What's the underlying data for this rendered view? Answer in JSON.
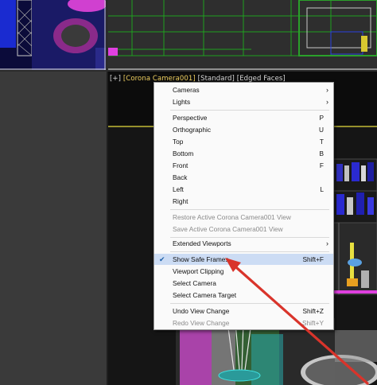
{
  "viewport": {
    "label_plus": "[+]",
    "label_camera": "[Corona Camera001]",
    "label_standard": "[Standard]",
    "label_mode": "[Edged Faces]"
  },
  "menu": {
    "items": [
      {
        "label": "Cameras",
        "shortcut": "",
        "submenu": true,
        "disabled": false
      },
      {
        "label": "Lights",
        "shortcut": "",
        "submenu": true,
        "disabled": false
      },
      {
        "label": "Perspective",
        "shortcut": "P",
        "submenu": false,
        "disabled": false
      },
      {
        "label": "Orthographic",
        "shortcut": "U",
        "submenu": false,
        "disabled": false
      },
      {
        "label": "Top",
        "shortcut": "T",
        "submenu": false,
        "disabled": false
      },
      {
        "label": "Bottom",
        "shortcut": "B",
        "submenu": false,
        "disabled": false
      },
      {
        "label": "Front",
        "shortcut": "F",
        "submenu": false,
        "disabled": false
      },
      {
        "label": "Back",
        "shortcut": "",
        "submenu": false,
        "disabled": false
      },
      {
        "label": "Left",
        "shortcut": "L",
        "submenu": false,
        "disabled": false
      },
      {
        "label": "Right",
        "shortcut": "",
        "submenu": false,
        "disabled": false
      },
      {
        "label": "Restore Active Corona Camera001 View",
        "shortcut": "",
        "submenu": false,
        "disabled": true
      },
      {
        "label": "Save Active Corona Camera001 View",
        "shortcut": "",
        "submenu": false,
        "disabled": true
      },
      {
        "label": "Extended Viewports",
        "shortcut": "",
        "submenu": true,
        "disabled": false
      },
      {
        "label": "Show Safe Frames",
        "shortcut": "Shift+F",
        "submenu": false,
        "disabled": false,
        "checked": true
      },
      {
        "label": "Viewport Clipping",
        "shortcut": "",
        "submenu": false,
        "disabled": false
      },
      {
        "label": "Select Camera",
        "shortcut": "",
        "submenu": false,
        "disabled": false
      },
      {
        "label": "Select Camera Target",
        "shortcut": "",
        "submenu": false,
        "disabled": false
      },
      {
        "label": "Undo View Change",
        "shortcut": "Shift+Z",
        "submenu": false,
        "disabled": false
      },
      {
        "label": "Redo View Change",
        "shortcut": "Shift+Y",
        "submenu": false,
        "disabled": true
      }
    ],
    "check_glyph": "✔",
    "submenu_glyph": "›"
  },
  "colors": {
    "annotation_arrow": "#d9342b",
    "safe_frame": "#e8e040",
    "menu_highlight": "#ccdcf4"
  }
}
